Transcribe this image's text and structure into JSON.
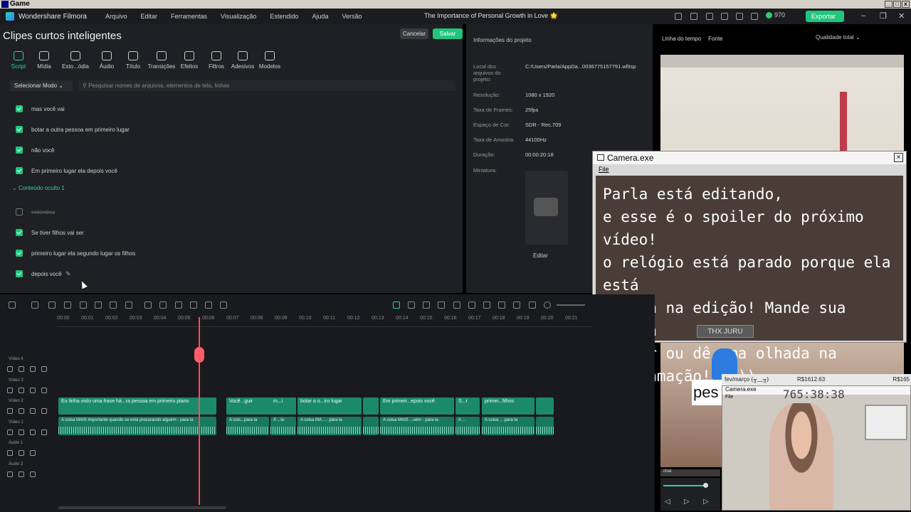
{
  "window": {
    "title": "Game"
  },
  "menubar": {
    "brand": "Wondershare Filmora",
    "items": [
      "Arquivo",
      "Editar",
      "Ferramentas",
      "Visualização",
      "Estendido",
      "Ajuda",
      "Versão"
    ],
    "project_title": "The Importance of Personal Growth in Love 🌟",
    "credits": "970",
    "export_label": "Exportar"
  },
  "header": {
    "title": "Clipes curtos inteligentes",
    "cancel": "Cancelar",
    "save": "Salvar"
  },
  "tools": [
    {
      "label": "Script",
      "icon": "script-icon"
    },
    {
      "label": "Mídia",
      "icon": "media-icon"
    },
    {
      "label": "Esto...ódia",
      "icon": "stock-icon"
    },
    {
      "label": "Áudio",
      "icon": "audio-icon"
    },
    {
      "label": "Título",
      "icon": "title-icon"
    },
    {
      "label": "Transições",
      "icon": "transitions-icon"
    },
    {
      "label": "Efeitos",
      "icon": "effects-icon"
    },
    {
      "label": "Filtros",
      "icon": "filters-icon"
    },
    {
      "label": "Adesivos",
      "icon": "stickers-icon"
    },
    {
      "label": "Modelos",
      "icon": "templates-icon"
    }
  ],
  "select_mode": "Selecionar Modo",
  "search_placeholder": "Pesquisar nomes de arquivos, elementos de tela, linhas",
  "script_lines": [
    {
      "text": "mas você vai",
      "checked": true
    },
    {
      "text": "botar a outra pessoa em primeiro lugar",
      "checked": true
    },
    {
      "text": "não você",
      "checked": true
    },
    {
      "text": "Em primeiro lugar ela depois você",
      "checked": true
    }
  ],
  "hidden_group": "Conteúdo oculto 1",
  "hidden_lines": [
    {
      "text": "entendeu",
      "checked": false
    },
    {
      "text": "Se tiver filhos vai ser",
      "checked": true
    },
    {
      "text": "primeiro lugar ela segundo lugar os filhos",
      "checked": true
    },
    {
      "text": "depois você",
      "checked": true
    }
  ],
  "project_info": {
    "title": "Informações do projeto",
    "path_label": "Local dos arquivos do projeto:",
    "path": "C:/Users/Parla/AppDa...0036775157791.wfitsp",
    "resolution_label": "Resolução:",
    "resolution": "1080 x 1920",
    "fps_label": "Taxa de Frames:",
    "fps": "25fps",
    "color_label": "Espaço de Cor:",
    "color": "SDR - Rec.709",
    "sample_label": "Taxa de Amostra:",
    "sample": "44100Hz",
    "duration_label": "Duração:",
    "duration": "00:00:20:18",
    "thumb_label": "Miniatura:",
    "edit": "Editar"
  },
  "preview_tabs": {
    "timeline": "Linha do tempo",
    "font": "Fonte",
    "quality": "Qualidade total"
  },
  "overlay": {
    "title": "Camera.exe",
    "menu": "File",
    "text": "Parla está editando,\ne esse é o spoiler do próximo vídeo!\no relógio está parado porque ela está\nfocada na edição! Mande sua música\nno !sr ou dê uma olhada na\nprogramação!  :))",
    "badge": "THX JURU"
  },
  "stream": {
    "pes": "pes",
    "counter_label": "fev/março",
    "counter_face": "(╥﹏╥)",
    "price1": "R$1612.63",
    "price2": "R$165",
    "cam_title": "Camera.exe",
    "cam_clock": "765:38:38",
    "cam_file": "File",
    "chat": "chat"
  },
  "timeline": {
    "ticks": [
      "00:00",
      "00:01",
      "00:02",
      "00:03",
      "00:04",
      "00:05",
      "00:06",
      "00:07",
      "00:08",
      "00:09",
      "00:10",
      "00:11",
      "00:12",
      "00:13",
      "00:14",
      "00:15",
      "00:16",
      "00:17",
      "00:18",
      "00:19",
      "00:20",
      "00:21"
    ],
    "tracks": [
      "Vídeo 4",
      "Vídeo 3",
      "Vídeo 2",
      "Vídeo 1",
      "Áudio 1",
      "Áudio 2"
    ],
    "clips_v2": [
      "Eu tinha visto uma frase há...ra pessoa em primeiro plano",
      "Você...guir",
      "m...i",
      "botar a o...iro lugar",
      "",
      "Em primeir...epois você",
      "S...r",
      "primei...filhos",
      ""
    ],
    "clips_v1": [
      "A coisa MAIS importante quando se está procurando alguém - para la",
      "A cois...para la",
      "A ...la",
      "A coisa MA... - para la",
      "",
      "A coisa MAIS ...uém - para la",
      "A ...",
      "A coisa ... para la",
      ""
    ]
  },
  "colors": {
    "accent": "#21c57e",
    "playhead": "#ff4b5c",
    "clip": "#1b8a6b"
  }
}
